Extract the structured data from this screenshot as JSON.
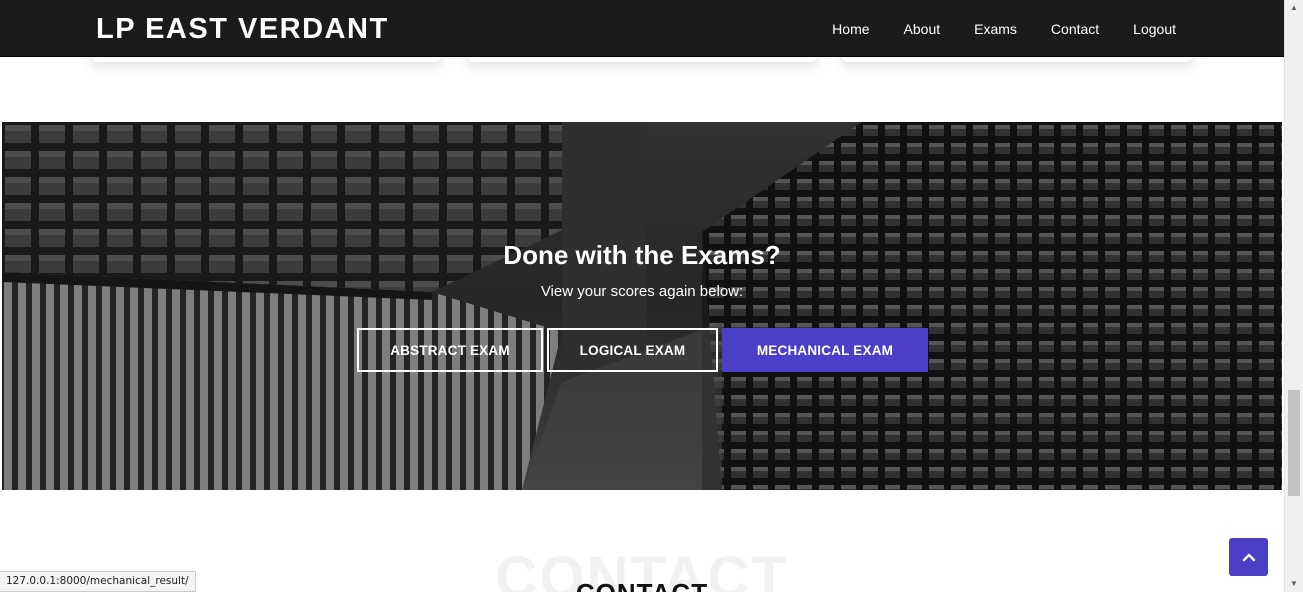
{
  "navbar": {
    "brand": "LP EAST VERDANT",
    "links": [
      "Home",
      "About",
      "Exams",
      "Contact",
      "Logout"
    ]
  },
  "hero": {
    "title": "Done with the Exams?",
    "subtitle": "View your scores again below:",
    "buttons": [
      "ABSTRACT EXAM",
      "LOGICAL EXAM",
      "MECHANICAL EXAM"
    ],
    "active_button": "MECHANICAL EXAM"
  },
  "contact": {
    "background_text": "CONTACT",
    "title": "CONTACT"
  },
  "status_bar": {
    "url": "127.0.0.1:8000/mechanical_result/"
  },
  "icons": {
    "back_to_top": "chevron-up-icon",
    "scroll_up": "triangle-up-icon",
    "scroll_down": "triangle-down-icon"
  },
  "colors": {
    "navbar_bg": "#1b1b1b",
    "accent": "#4b3fc7",
    "text_light": "#ffffff"
  }
}
